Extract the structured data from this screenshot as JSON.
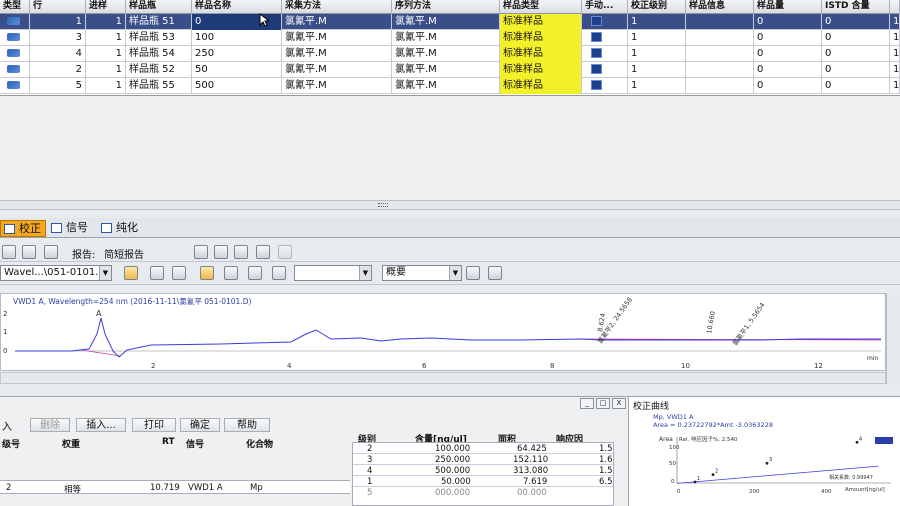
{
  "grid": {
    "headers": [
      "类型",
      "行",
      "进样",
      "样品瓶",
      "样品名称",
      "采集方法",
      "序列方法",
      "样品类型",
      "手动...",
      "校正级别",
      "样品信息",
      "样品量",
      "ISTD 含量"
    ],
    "rows": [
      {
        "line": "1",
        "inj": "1",
        "vial": "样品瓶 51",
        "name": "0",
        "acq": "氯氰平.M",
        "seq": "氯氰平.M",
        "type": "标准样品",
        "level": "1",
        "amt": "0",
        "istd": "0",
        "extra": "1"
      },
      {
        "line": "3",
        "inj": "1",
        "vial": "样品瓶 53",
        "name": "100",
        "acq": "氯氰平.M",
        "seq": "氯氰平.M",
        "type": "标准样品",
        "level": "1",
        "amt": "0",
        "istd": "0",
        "extra": "1"
      },
      {
        "line": "4",
        "inj": "1",
        "vial": "样品瓶 54",
        "name": "250",
        "acq": "氯氰平.M",
        "seq": "氯氰平.M",
        "type": "标准样品",
        "level": "1",
        "amt": "0",
        "istd": "0",
        "extra": "1"
      },
      {
        "line": "2",
        "inj": "1",
        "vial": "样品瓶 52",
        "name": "50",
        "acq": "氯氰平.M",
        "seq": "氯氰平.M",
        "type": "标准样品",
        "level": "1",
        "amt": "0",
        "istd": "0",
        "extra": "1"
      },
      {
        "line": "5",
        "inj": "1",
        "vial": "样品瓶 55",
        "name": "500",
        "acq": "氯氰平.M",
        "seq": "氯氰平.M",
        "type": "标准样品",
        "level": "1",
        "amt": "0",
        "istd": "0",
        "extra": "1"
      }
    ]
  },
  "tabs": [
    {
      "label": "校正"
    },
    {
      "label": "信号"
    },
    {
      "label": "纯化"
    }
  ],
  "report": {
    "label": "报告:",
    "value": "简短报告"
  },
  "signal_combo": "Wavel...\\051-0101.D)",
  "view_combo": "概要",
  "chrom": {
    "title": "VWD1 A, Wavelength=254 nm (2016-11-11\\氯氰平 051-0101.D)",
    "y_ticks": [
      "2",
      "1",
      "0"
    ],
    "x_ticks": [
      "2",
      "4",
      "6",
      "8",
      "10",
      "12"
    ],
    "x_unit": "min",
    "peak_A": "A",
    "peak1_label": "8.624",
    "peak1_name": "氯氰平2, 24.5658",
    "peak2_label": "10.660",
    "peak2_name": "氯氰平1, 5.5654"
  },
  "bottom_bar": {
    "left_label": "入",
    "buttons": [
      "删除",
      "插入...",
      "打印",
      "确定",
      "帮助"
    ]
  },
  "compound_table": {
    "headers": [
      "级号",
      "权重",
      "RT",
      "信号",
      "化合物"
    ],
    "row": {
      "no": "2",
      "weight": "相等",
      "rt": "10.719",
      "signal": "VWD1 A",
      "compound": "Mp"
    }
  },
  "level_table": {
    "headers": [
      "级别",
      "含量[ng/ul]",
      "面积",
      "响应因"
    ],
    "rows": [
      {
        "level": "2",
        "amount": "100.000",
        "area": "64.425",
        "rf": "1.5"
      },
      {
        "level": "3",
        "amount": "250.000",
        "area": "152.110",
        "rf": "1.6"
      },
      {
        "level": "4",
        "amount": "500.000",
        "area": "313.080",
        "rf": "1.5"
      },
      {
        "level": "1",
        "amount": "50.000",
        "area": "7.619",
        "rf": "6.5"
      },
      {
        "level": "5",
        "amount": "000.000",
        "area": "00.000",
        "rf": ""
      }
    ]
  },
  "window_buttons": [
    "_",
    "□",
    "X"
  ],
  "calib": {
    "title": "校正曲线",
    "series": "Mp, VWD1 A",
    "equation": "Area = 0.23722792*Amt -3.0363228",
    "corr": "Rel. 响应因子%: 2.540",
    "y_label": "Area",
    "x_label": "Amount[ng/ul]",
    "x_ticks": [
      "0",
      "200",
      "400"
    ],
    "y_ticks": [
      "100",
      "50",
      "0"
    ],
    "corr2": "相关系数: 0.99947",
    "points": [
      {
        "lbl": "1",
        "x": 50,
        "y": 7.6
      },
      {
        "lbl": "2",
        "x": 100,
        "y": 64.4
      },
      {
        "lbl": "3",
        "x": 250,
        "y": 152.1
      },
      {
        "lbl": "4",
        "x": 500,
        "y": 313.1
      }
    ]
  }
}
